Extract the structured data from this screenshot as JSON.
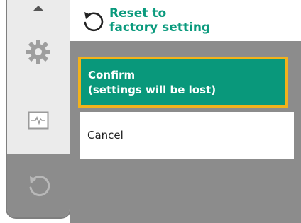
{
  "header": {
    "title": "Reset to\nfactory setting",
    "icon": "reset-arrow-icon"
  },
  "menu": {
    "items": [
      {
        "name": "up-arrow-icon"
      },
      {
        "name": "gear-icon"
      },
      {
        "name": "graph-icon"
      },
      {
        "name": "reset-icon"
      }
    ]
  },
  "options": {
    "confirm_label": "Confirm\n(settings will be lost)",
    "cancel_label": "Cancel"
  },
  "colors": {
    "accent": "#0a9a7d",
    "focus": "#f2b21b",
    "panel": "#8c8c8c"
  }
}
